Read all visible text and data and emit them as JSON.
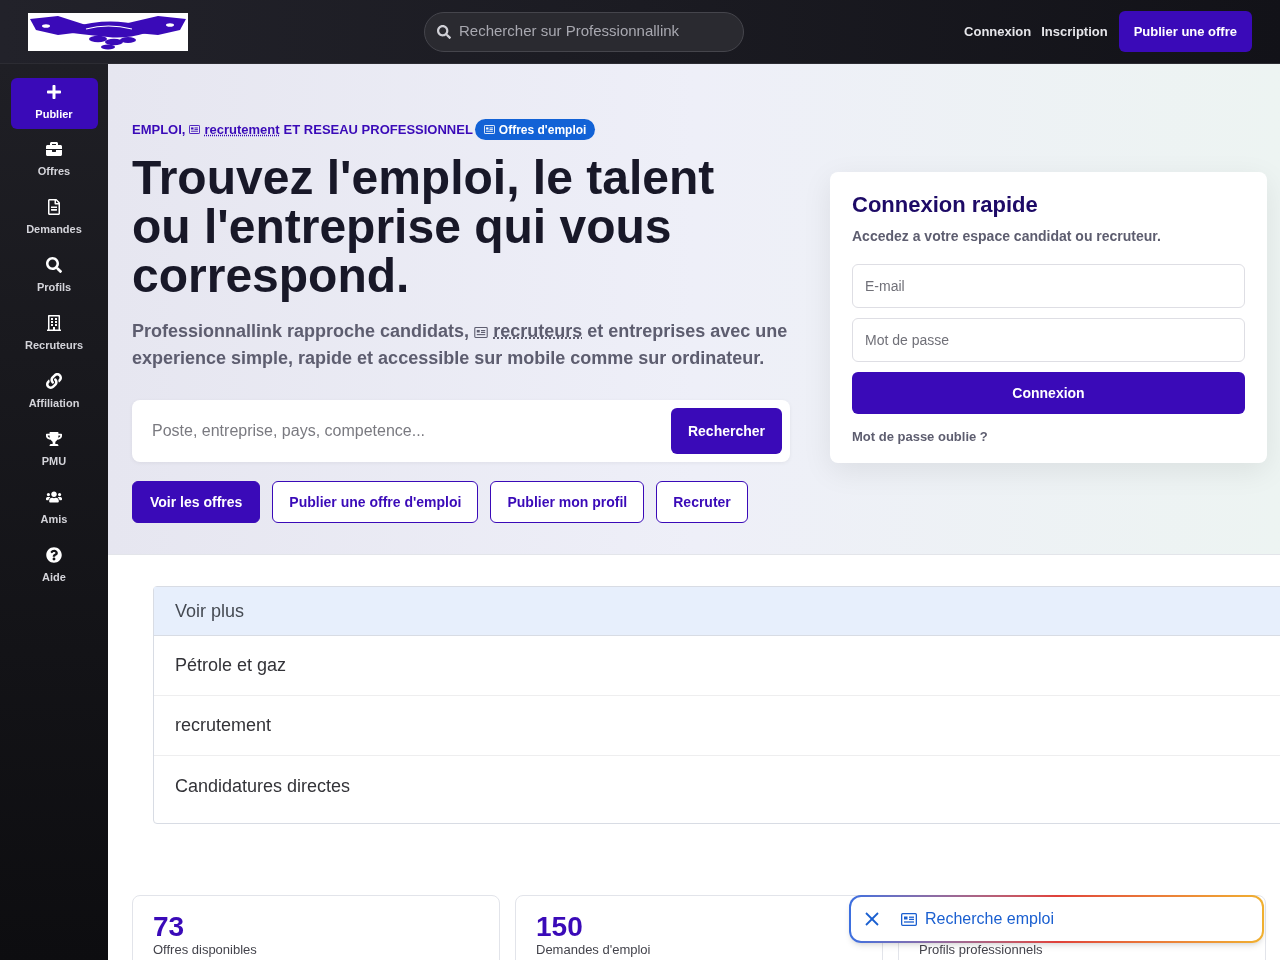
{
  "header": {
    "search": {
      "placeholder": "Rechercher sur Professionnallink"
    },
    "links": [
      "Connexion",
      "Inscription"
    ],
    "cta": "Publier une offre"
  },
  "sidebar": {
    "items": [
      {
        "label": "Publier",
        "selected": true
      },
      {
        "label": "Offres",
        "selected": false
      },
      {
        "label": "Demandes",
        "selected": false
      },
      {
        "label": "Profils",
        "selected": false
      },
      {
        "label": "Recruteurs",
        "selected": false
      },
      {
        "label": "Affiliation",
        "selected": false
      },
      {
        "label": "PMU",
        "selected": false
      },
      {
        "label": "Amis",
        "selected": false
      },
      {
        "label": "Aide",
        "selected": false
      }
    ]
  },
  "hero": {
    "tagline": {
      "before": "EMPLOI,",
      "link": "recrutement",
      "after": "ET RESEAU PROFESSIONNEL"
    },
    "badge": "Offres d'emploi",
    "title": "Trouvez l'emploi, le talent ou l'entreprise qui vous correspond.",
    "intro": {
      "before": "Professionnallink rapproche candidats,",
      "link": "recruteurs",
      "after": "et entreprises avec une experience simple, rapide et accessible sur mobile comme sur ordinateur."
    },
    "search": {
      "placeholder": "Poste, entreprise, pays, competence...",
      "button": "Rechercher"
    },
    "actions": [
      {
        "label": "Voir les offres",
        "kind": "primary"
      },
      {
        "label": "Publier une offre d'emploi",
        "kind": "outline"
      },
      {
        "label": "Publier mon profil",
        "kind": "outline"
      },
      {
        "label": "Recruter",
        "kind": "outline"
      }
    ]
  },
  "login": {
    "title": "Connexion rapide",
    "subtitle": "Accedez a votre espace candidat ou recruteur.",
    "email": {
      "placeholder": "E-mail"
    },
    "password": {
      "placeholder": "Mot de passe"
    },
    "button": "Connexion",
    "forgot": "Mot de passe oublie ?"
  },
  "more_panel": {
    "title": "Voir plus",
    "items": [
      "Pétrole et gaz",
      "recrutement",
      "Candidatures directes"
    ]
  },
  "stats": [
    {
      "value": "73",
      "label": "Offres disponibles"
    },
    {
      "value": "150",
      "label": "Demandes d'emploi"
    },
    {
      "label": "Profils professionnels"
    }
  ],
  "floating_chip": {
    "label": "Recherche emploi"
  }
}
